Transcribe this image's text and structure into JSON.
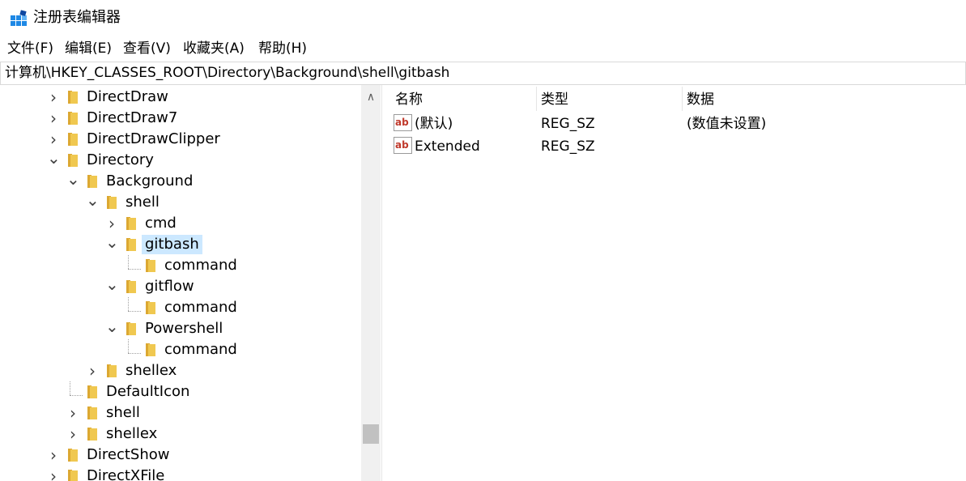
{
  "window": {
    "title": "注册表编辑器"
  },
  "menu": [
    "文件(F)",
    "编辑(E)",
    "查看(V)",
    "收藏夹(A)",
    "帮助(H)"
  ],
  "address": "计算机\\HKEY_CLASSES_ROOT\\Directory\\Background\\shell\\gitbash",
  "tree": [
    {
      "label": "DirectDraw",
      "expander": "collapsed"
    },
    {
      "label": "DirectDraw7",
      "expander": "collapsed"
    },
    {
      "label": "DirectDrawClipper",
      "expander": "collapsed"
    },
    {
      "label": "Directory",
      "expander": "expanded"
    },
    {
      "label": "Background",
      "expander": "expanded"
    },
    {
      "label": "shell",
      "expander": "expanded"
    },
    {
      "label": "cmd",
      "expander": "collapsed"
    },
    {
      "label": "gitbash",
      "expander": "expanded",
      "selected": true
    },
    {
      "label": "command",
      "expander": "none"
    },
    {
      "label": "gitflow",
      "expander": "expanded"
    },
    {
      "label": "command",
      "expander": "none"
    },
    {
      "label": "Powershell",
      "expander": "expanded"
    },
    {
      "label": "command",
      "expander": "none"
    },
    {
      "label": "shellex",
      "expander": "collapsed"
    },
    {
      "label": "DefaultIcon",
      "expander": "none"
    },
    {
      "label": "shell",
      "expander": "collapsed"
    },
    {
      "label": "shellex",
      "expander": "collapsed"
    },
    {
      "label": "DirectShow",
      "expander": "collapsed"
    },
    {
      "label": "DirectXFile",
      "expander": "collapsed"
    }
  ],
  "list": {
    "headers": {
      "name": "名称",
      "type": "类型",
      "data": "数据"
    },
    "rows": [
      {
        "name": "(默认)",
        "type": "REG_SZ",
        "data": "(数值未设置)"
      },
      {
        "name": "Extended",
        "type": "REG_SZ",
        "data": ""
      }
    ]
  },
  "colors": {
    "selection": "#cce8ff",
    "folder": "#f0c850",
    "folder_dark": "#dca832",
    "string_icon": "#c0392b"
  }
}
